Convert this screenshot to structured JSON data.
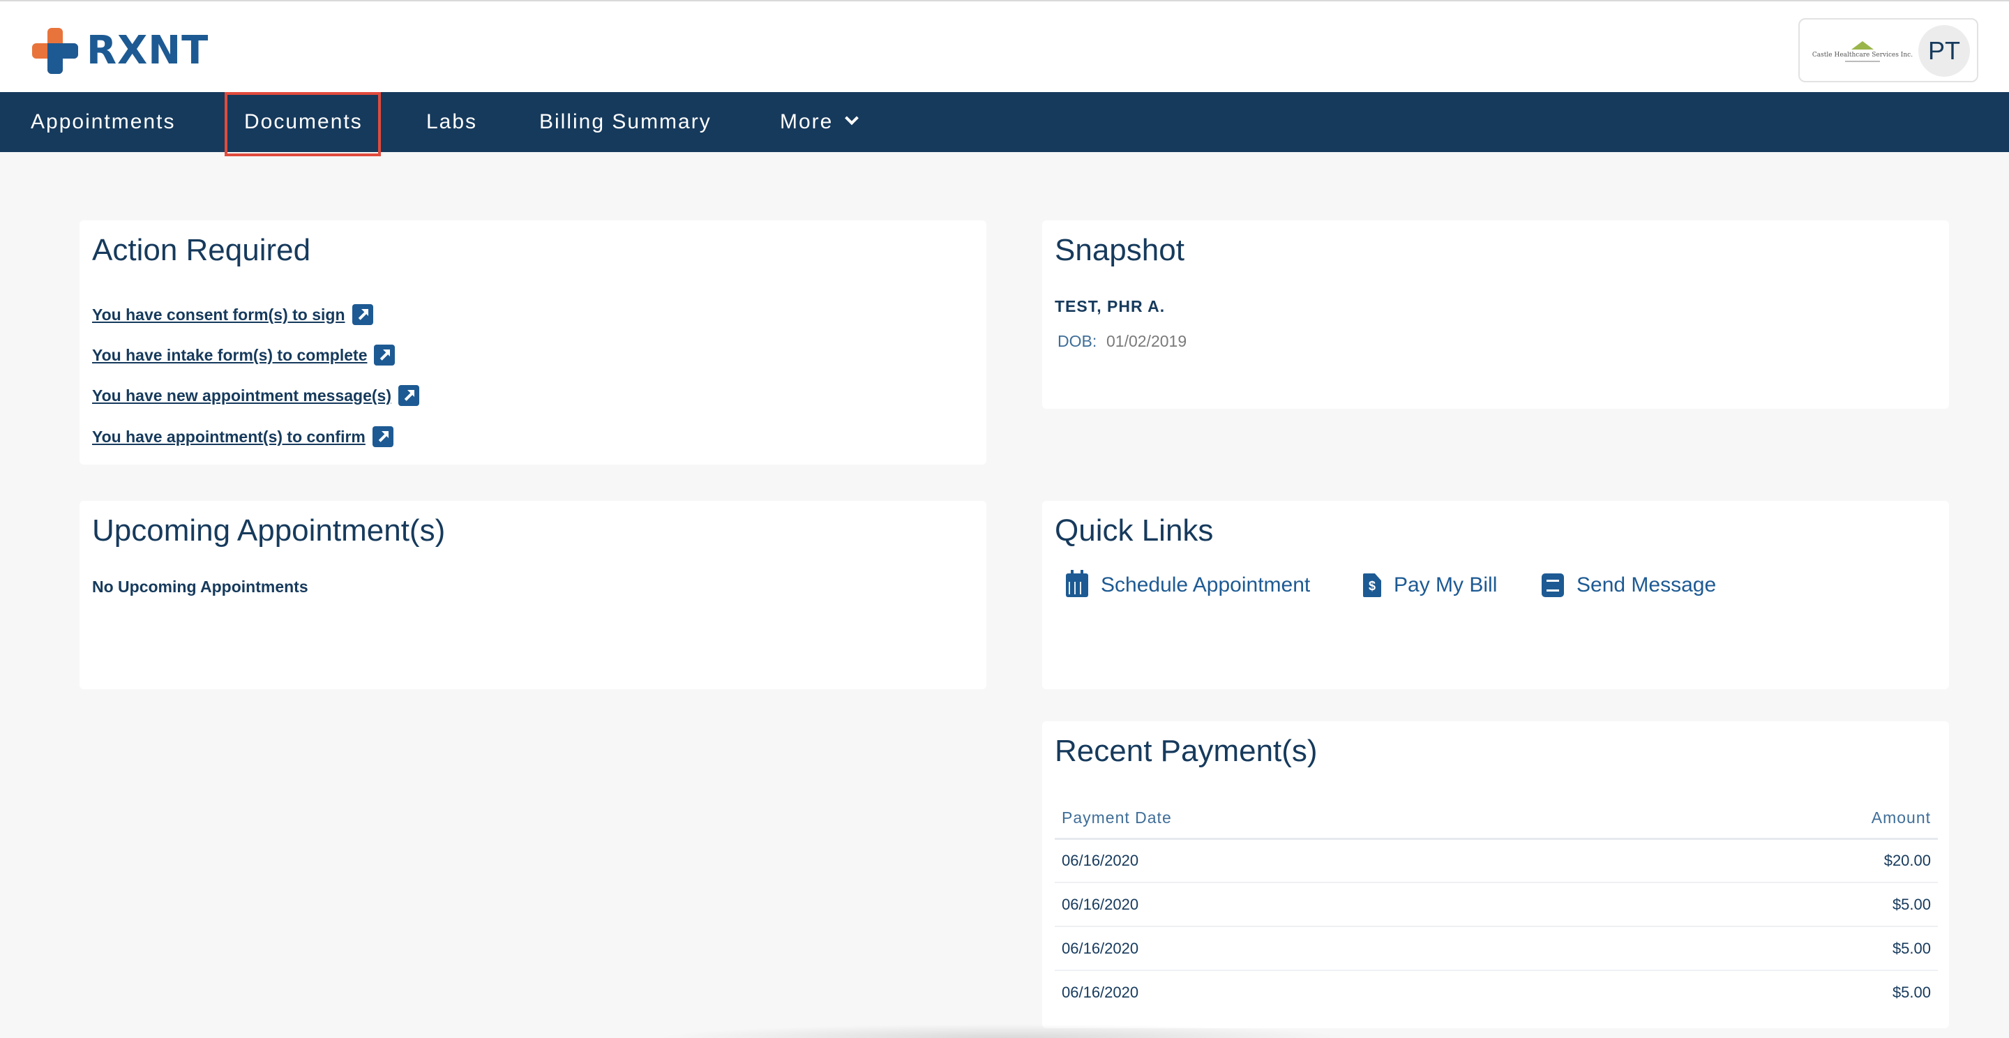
{
  "brand": {
    "name": "RXNT",
    "logo_orange": "#e8743b",
    "logo_blue": "#1d5a93"
  },
  "profile": {
    "initials": "PT",
    "practice_name": "Castle Healthcare Services Inc."
  },
  "nav": {
    "items": [
      {
        "label": "Appointments"
      },
      {
        "label": "Documents",
        "active": true
      },
      {
        "label": "Labs"
      },
      {
        "label": "Billing Summary"
      },
      {
        "label": "More"
      }
    ],
    "bar_color": "#163a5c",
    "highlight_color": "#e04b3c"
  },
  "action_required": {
    "title": "Action Required",
    "links": [
      {
        "label": "You have consent form(s) to sign",
        "icon": "external-link-icon"
      },
      {
        "label": "You have intake form(s) to complete",
        "icon": "external-link-icon"
      },
      {
        "label": "You have new appointment message(s)",
        "icon": "external-link-icon"
      },
      {
        "label": "You have appointment(s) to confirm",
        "icon": "external-link-icon"
      }
    ]
  },
  "snapshot": {
    "title": "Snapshot",
    "patient_name": "TEST, PHR A.",
    "dob_label": "DOB:",
    "dob_value": "01/02/2019"
  },
  "upcoming": {
    "title": "Upcoming Appointment(s)",
    "empty_text": "No Upcoming Appointments"
  },
  "quick_links": {
    "title": "Quick Links",
    "items": [
      {
        "label": "Schedule Appointment",
        "icon": "calendar-icon"
      },
      {
        "label": "Pay My Bill",
        "icon": "bill-icon"
      },
      {
        "label": "Send Message",
        "icon": "message-icon"
      }
    ]
  },
  "payments": {
    "title": "Recent Payment(s)",
    "columns": [
      "Payment Date",
      "Amount"
    ],
    "rows": [
      {
        "date": "06/16/2020",
        "amount": "$20.00"
      },
      {
        "date": "06/16/2020",
        "amount": "$5.00"
      },
      {
        "date": "06/16/2020",
        "amount": "$5.00"
      },
      {
        "date": "06/16/2020",
        "amount": "$5.00"
      }
    ]
  }
}
